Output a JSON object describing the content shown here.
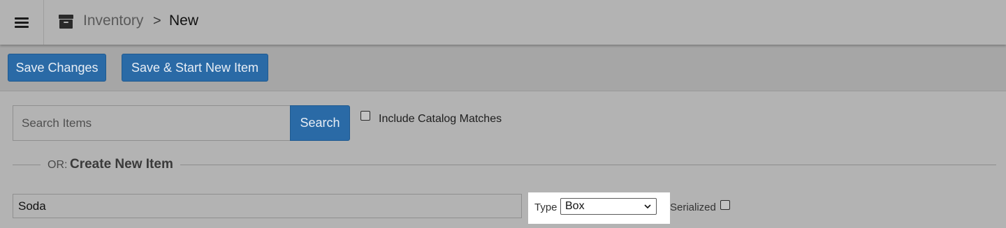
{
  "header": {
    "menu_icon": "hamburger-menu-icon",
    "section_icon": "archive-box-icon",
    "breadcrumb_parent": "Inventory",
    "breadcrumb_separator": ">",
    "breadcrumb_current": "New"
  },
  "toolbar": {
    "save_label": "Save Changes",
    "save_new_label": "Save & Start New Item",
    "button_color": "#2a6aa6"
  },
  "search": {
    "placeholder": "Search Items",
    "button_label": "Search",
    "include_catalog_label": "Include Catalog Matches",
    "include_catalog_checked": false
  },
  "create": {
    "or_label": "OR:",
    "title": "Create New Item",
    "name_value": "Soda",
    "type_label": "Type",
    "type_value": "Box",
    "serialized_label": "Serialized",
    "serialized_checked": false
  }
}
